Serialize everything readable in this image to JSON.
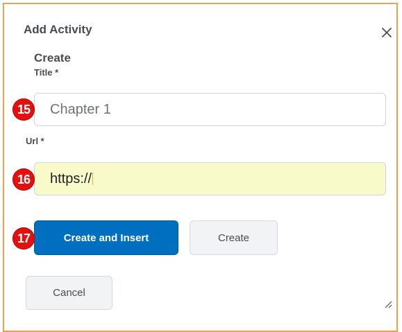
{
  "dialog": {
    "title": "Add Activity",
    "close_icon": "close-icon"
  },
  "form": {
    "section_heading": "Create",
    "title_label": "Title *",
    "title_value": "Chapter 1",
    "url_label": "Url *",
    "url_value": "https://"
  },
  "badges": {
    "title_step": "15",
    "url_step": "16",
    "button_step": "17"
  },
  "buttons": {
    "create_and_insert": "Create and Insert",
    "create": "Create",
    "cancel": "Cancel"
  },
  "icons": {
    "resize": "resize-handle-icon"
  },
  "colors": {
    "primary": "#006fbf",
    "badge": "#e3100f",
    "frame": "#f0a048",
    "url_highlight": "#f8fbc9"
  }
}
